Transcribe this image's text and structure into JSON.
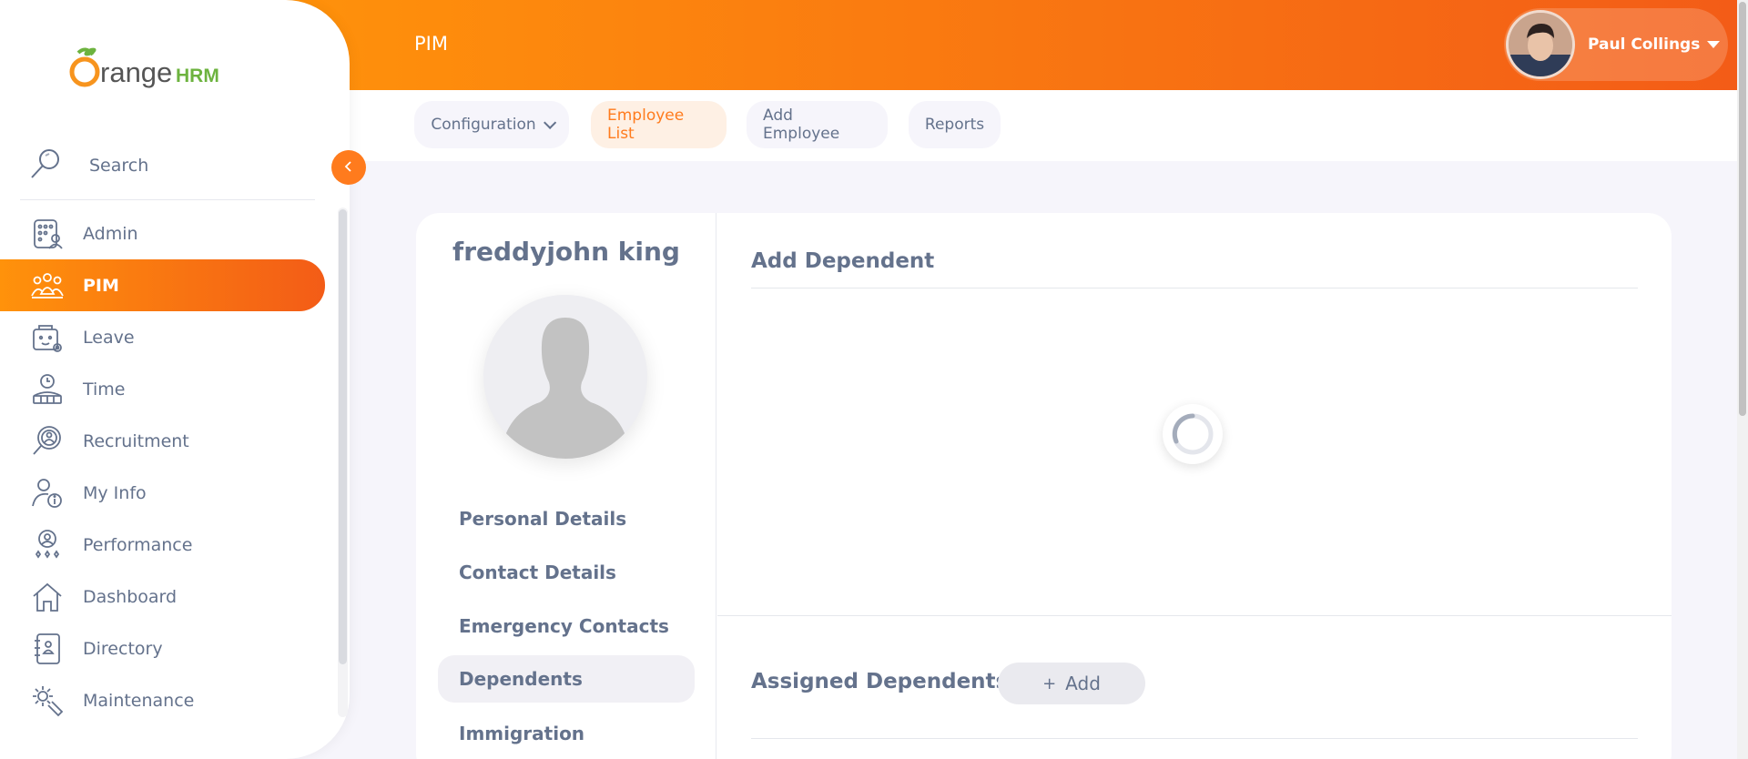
{
  "app": {
    "brand_name": "OrangeHRM",
    "accent_color": "#ff7b1d"
  },
  "header": {
    "module_title": "PIM",
    "user_name": "Paul Collings"
  },
  "sidebar": {
    "search_label": "Search",
    "items": [
      {
        "label": "Admin",
        "icon": "admin-icon"
      },
      {
        "label": "PIM",
        "icon": "pim-icon",
        "active": true
      },
      {
        "label": "Leave",
        "icon": "leave-icon"
      },
      {
        "label": "Time",
        "icon": "time-icon"
      },
      {
        "label": "Recruitment",
        "icon": "recruitment-icon"
      },
      {
        "label": "My Info",
        "icon": "my-info-icon"
      },
      {
        "label": "Performance",
        "icon": "performance-icon"
      },
      {
        "label": "Dashboard",
        "icon": "dashboard-icon"
      },
      {
        "label": "Directory",
        "icon": "directory-icon"
      },
      {
        "label": "Maintenance",
        "icon": "maintenance-icon"
      }
    ]
  },
  "subnav": {
    "configuration": "Configuration",
    "employee_list": "Employee List",
    "add_employee": "Add Employee",
    "reports": "Reports"
  },
  "employee": {
    "name": "freddyjohn king",
    "tabs": [
      "Personal Details",
      "Contact Details",
      "Emergency Contacts",
      "Dependents",
      "Immigration"
    ],
    "active_tab": "Dependents"
  },
  "main": {
    "add_title": "Add Dependent",
    "assigned_title": "Assigned Dependents",
    "add_button": "Add",
    "add_icon": "+"
  }
}
